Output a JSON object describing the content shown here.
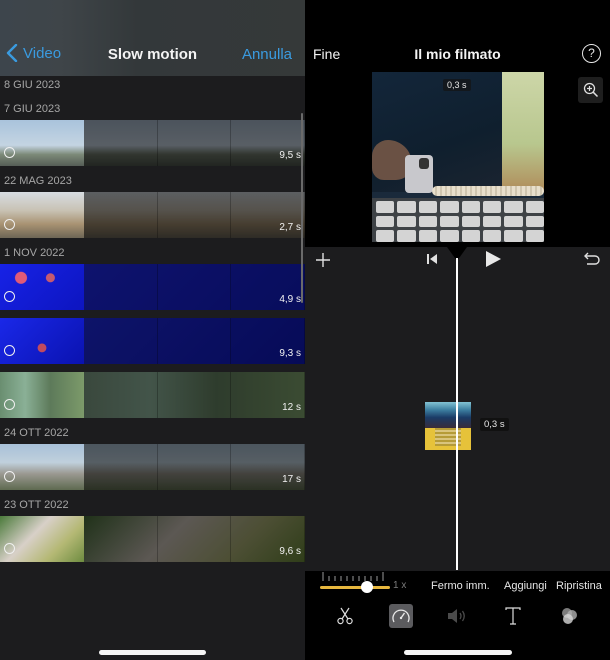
{
  "left": {
    "nav": {
      "back_label": "Video",
      "title": "Slow motion",
      "cancel_label": "Annulla"
    },
    "sections": [
      {
        "date": "8 GIU 2023",
        "clips": []
      },
      {
        "date": "7 GIU 2023",
        "clips": [
          {
            "duration": "9,5 s",
            "theme": "sky"
          }
        ]
      },
      {
        "date": "22 MAG 2023",
        "clips": [
          {
            "duration": "2,7 s",
            "theme": "building"
          }
        ]
      },
      {
        "date": "1 NOV 2022",
        "clips": [
          {
            "duration": "4,9 s",
            "theme": "jelly"
          },
          {
            "duration": "9,3 s",
            "theme": "jelly2"
          },
          {
            "duration": "12 s",
            "theme": "aquarium"
          }
        ]
      },
      {
        "date": "24 OTT 2022",
        "clips": [
          {
            "duration": "17 s",
            "theme": "roof"
          }
        ]
      },
      {
        "date": "23 OTT 2022",
        "clips": [
          {
            "duration": "9,6 s",
            "theme": "garden"
          }
        ]
      }
    ]
  },
  "right": {
    "nav": {
      "done_label": "Fine",
      "title": "Il mio filmato",
      "help_icon": "?"
    },
    "preview": {
      "duration_label": "0,3 s"
    },
    "timeline": {
      "clip_duration": "0,3 s"
    },
    "speed": {
      "value_label": "1 x",
      "fraction": 0.67
    },
    "actions": {
      "freeze_label": "Fermo imm.",
      "add_label": "Aggiungi",
      "reset_label": "Ripristina"
    },
    "tools": [
      {
        "name": "scissors-icon",
        "active": false
      },
      {
        "name": "speedometer-icon",
        "active": true
      },
      {
        "name": "volume-icon",
        "active": false
      },
      {
        "name": "text-icon",
        "active": false
      },
      {
        "name": "filters-icon",
        "active": false
      }
    ],
    "colors": {
      "accent": "#e7b73e",
      "link": "#3a9be0"
    }
  }
}
